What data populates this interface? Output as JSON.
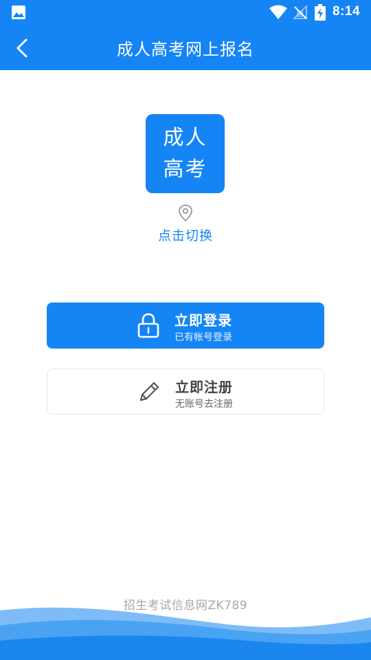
{
  "status_bar": {
    "time": "8:14",
    "icons": [
      "gallery-icon",
      "wifi-icon",
      "signal-off-icon",
      "battery-charging-icon"
    ]
  },
  "app_bar": {
    "title": "成人高考网上报名",
    "back_icon": "chevron-left-icon"
  },
  "logo": {
    "line1": "成人",
    "line2": "高考"
  },
  "location": {
    "icon": "location-pin-icon",
    "label": "点击切换"
  },
  "actions": {
    "login": {
      "icon": "lock-icon",
      "title": "立即登录",
      "subtitle": "已有帐号登录"
    },
    "register": {
      "icon": "pencil-icon",
      "title": "立即注册",
      "subtitle": "无账号去注册"
    }
  },
  "footer": {
    "text": "招生考试信息网ZK789"
  },
  "colors": {
    "primary": "#1585f5",
    "footer_text": "#a8a8a8",
    "wave_light": "#5aaaf5",
    "wave_dark": "#1a86ee"
  }
}
